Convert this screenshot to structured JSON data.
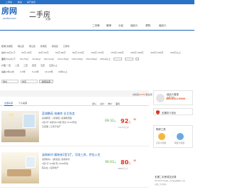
{
  "topbar": {
    "links": [
      "二手房",
      "新房",
      "房产资讯"
    ]
  },
  "header": {
    "logo_text": "房网",
    "logo_sub": "soufun.com",
    "site_title": "二手房",
    "city": "无锡"
  },
  "nav": {
    "items": [
      "二手房",
      "新房",
      "小区",
      "经纪人",
      "求购",
      "经纪人"
    ]
  },
  "filters": {
    "rows": [
      {
        "label": "区域：",
        "options": [
          "滨湖区",
          "锡山区",
          "惠山区",
          "新吴区",
          "梁溪区",
          "江阴市"
        ]
      },
      {
        "label": "总价：",
        "options": [
          "30万以下",
          "30万-40万",
          "40万-50万",
          "50万-80万",
          "80万-100万",
          "100万-150万",
          "150万-200万",
          "200万-300万",
          "300万-500万",
          "500万以上"
        ]
      },
      {
        "label": "面积：",
        "options": [
          "50㎡以下",
          "50-70㎡",
          "70-90㎡",
          "90-110㎡",
          "110-130㎡",
          "130-150㎡",
          "150-200㎡",
          "200㎡以上"
        ]
      },
      {
        "label": "户型：",
        "options": [
          "一室",
          "二室",
          "三室",
          "四室",
          "五室",
          "五室以上"
        ]
      },
      {
        "label": "房龄：",
        "options": [
          "2年以内",
          "2-5年",
          "5-10年",
          "10-20年",
          "20年以上"
        ]
      }
    ],
    "selects": [
      "朝向",
      "楼层"
    ],
    "search_button": "搜索房源"
  },
  "results": {
    "count_prefix": "共找到",
    "count": "16350",
    "count_suffix": "套房源"
  },
  "tabs": [
    {
      "label": "全部房源",
      "active": true
    },
    {
      "label": "个人房源",
      "active": false
    }
  ],
  "sort": [
    "默认",
    "总价",
    "单价",
    "面积"
  ],
  "listings": [
    {
      "title": "蓝湖鹏苑 电梯房 业主急卖",
      "location": "蓝湖鹏苑 - [滨湖区] 蓝湖鹏苑路",
      "details": "2室2厅  中层/共18层  南北  2010年建",
      "agent": "王经理  |  江南不动产",
      "area": "69.32",
      "area_unit": "㎡",
      "price": "92",
      "price_unit": "万",
      "unit_price": "13272元/㎡"
    },
    {
      "title": "溪南新村 精装修2室1厅，可改三房，拎包入住",
      "location": "溪南新村 - [梁溪区] 溪南新村",
      "details": "2室1厅  6/6层  南  1996年建",
      "agent": "陈先生  |  链家地产",
      "area": "90.01",
      "area_unit": "㎡",
      "price": "80",
      "price_unit": "万",
      "unit_price": "8888元/㎡"
    }
  ],
  "sidebar": {
    "agent": {
      "title": "经纪人登录",
      "phone_label": "免费咨询",
      "phone": "400-6111-0000"
    },
    "cert": {
      "title": "无锡中介评价"
    },
    "tools": {
      "title": "购房工具",
      "items": [
        "房贷计算器",
        "税费计算器"
      ]
    },
    "news": {
      "title": "无锡二手房成交记录",
      "items": [
        "2023年03月无锡二手房成交量环比上涨",
        "无锡二手房均价"
      ]
    }
  },
  "colors": {
    "brand": "#1f63b8",
    "price": "#e0301e",
    "accent": "#e0581e",
    "area": "#4aa52e"
  }
}
